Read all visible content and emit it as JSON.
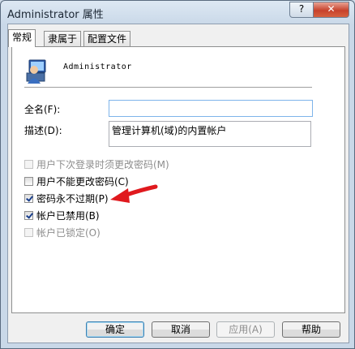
{
  "window": {
    "title": "Administrator 属性",
    "help_glyph": "?",
    "close_glyph": "✕"
  },
  "tabs": [
    {
      "label": "常规",
      "active": true
    },
    {
      "label": "隶属于",
      "active": false
    },
    {
      "label": "配置文件",
      "active": false
    }
  ],
  "user": {
    "name": "Administrator"
  },
  "fields": {
    "fullname": {
      "label": "全名(F):",
      "value": ""
    },
    "description": {
      "label": "描述(D):",
      "value": "管理计算机(域)的内置帐户"
    }
  },
  "checkboxes": [
    {
      "label": "用户下次登录时须更改密码(M)",
      "checked": false,
      "disabled": true
    },
    {
      "label": "用户不能更改密码(C)",
      "checked": false,
      "disabled": false
    },
    {
      "label": "密码永不过期(P)",
      "checked": true,
      "disabled": false
    },
    {
      "label": "帐户已禁用(B)",
      "checked": true,
      "disabled": false
    },
    {
      "label": "帐户已锁定(O)",
      "checked": false,
      "disabled": true
    }
  ],
  "buttons": {
    "ok": "确定",
    "cancel": "取消",
    "apply": "应用(A)",
    "help": "帮助"
  },
  "colors": {
    "annotation_arrow": "#e0191e",
    "title_bar": "#cfdbe8",
    "close_button": "#c7422c"
  }
}
